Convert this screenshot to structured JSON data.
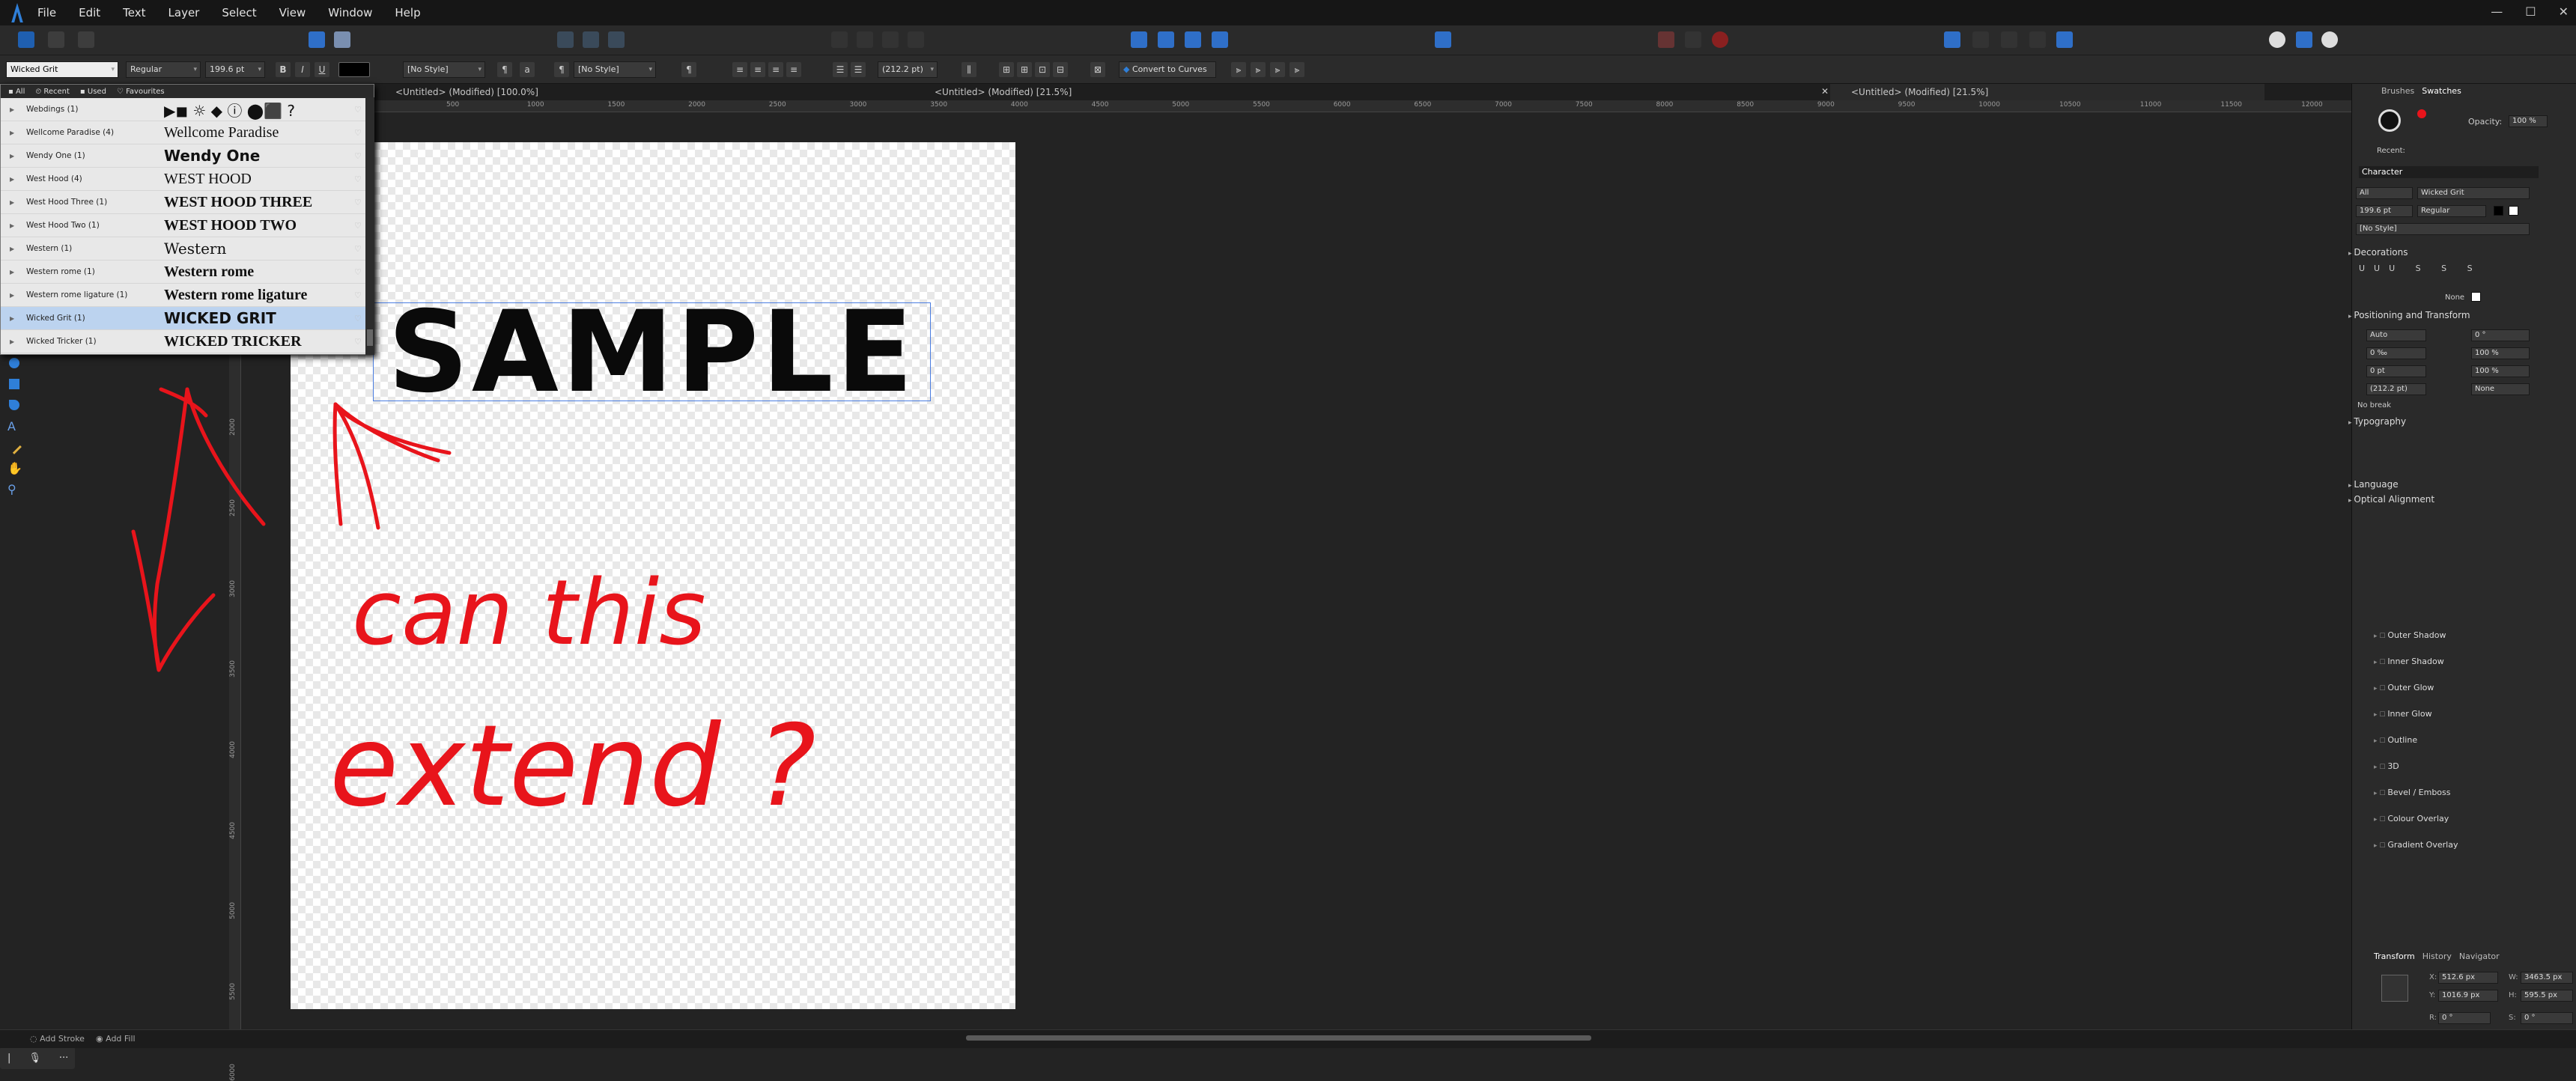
{
  "menu": [
    "File",
    "Edit",
    "Text",
    "Layer",
    "Select",
    "View",
    "Window",
    "Help"
  ],
  "window_controls": [
    "—",
    "☐",
    "✕"
  ],
  "context": {
    "font_family": "Wicked Grit",
    "font_style": "Regular",
    "font_size": "199.6 pt",
    "para_style": "[No Style]",
    "char_style": "[No Style]",
    "leading": "(212.2 pt)",
    "convert": "Convert to Curves"
  },
  "tabs": [
    "<Untitled> (Modified) [100.0%]",
    "<Untitled> (Modified) [21.5%]",
    "<Untitled> (Modified) [21.5%]"
  ],
  "ruler_top": [
    "500",
    "1000",
    "1500",
    "2000",
    "2500",
    "3000",
    "3500",
    "4000",
    "4500",
    "5000",
    "5500",
    "6000",
    "6500",
    "7000",
    "7500",
    "8000",
    "8500",
    "9000",
    "9500",
    "10000",
    "10500",
    "11000",
    "11500",
    "12000"
  ],
  "ruler_left": [
    "500",
    "1000",
    "1500",
    "2000",
    "2500",
    "3000",
    "3500",
    "4000",
    "4500",
    "5000",
    "5500",
    "6000"
  ],
  "font_filter": [
    "All",
    "Recent",
    "Used",
    "Favourites"
  ],
  "fonts": [
    {
      "name": "Webdings (1)",
      "preview": "▶◼ ☼ ◆ ⓘ ⬤⬛ ?"
    },
    {
      "name": "Wellcome Paradise (4)",
      "preview": "Wellcome Paradise"
    },
    {
      "name": "Wendy One (1)",
      "preview": "Wendy One"
    },
    {
      "name": "West Hood (4)",
      "preview": "WEST HOOD"
    },
    {
      "name": "West Hood Three (1)",
      "preview": "WEST HOOD THREE"
    },
    {
      "name": "West Hood Two (1)",
      "preview": "WEST HOOD TWO"
    },
    {
      "name": "Western (1)",
      "preview": "Western"
    },
    {
      "name": "Western rome (1)",
      "preview": "Western rome"
    },
    {
      "name": "Western rome ligature (1)",
      "preview": "Western rome ligature"
    },
    {
      "name": "Wicked Grit (1)",
      "preview": "WICKED GRIT",
      "selected": true
    },
    {
      "name": "Wicked Tricker (1)",
      "preview": "WICKED TRICKER"
    }
  ],
  "canvas_text": "SAMPLE",
  "right": {
    "top_tabs": [
      "Brushes",
      "Swatches"
    ],
    "opacity_label": "Opacity:",
    "opacity": "100 %",
    "recent": "Recent:",
    "character_title": "Character",
    "char_all": "All",
    "char_font": "Wicked Grit",
    "char_size": "199.6 pt",
    "char_style": "Regular",
    "char_nostyle": "[No Style]",
    "decorations": "Decorations",
    "none": "None",
    "positioning": "Positioning and Transform",
    "pos_fields": [
      "Auto",
      "0 ‰",
      "0 pt",
      "(212.2 pt)"
    ],
    "pos_fields_r": [
      "0 °",
      "100 %",
      "100 %",
      "None"
    ],
    "no_break": "No break",
    "typography": "Typography",
    "language": "Language",
    "optical": "Optical Alignment",
    "effects": [
      "Outer Shadow",
      "Inner Shadow",
      "Outer Glow",
      "Inner Glow",
      "Outline",
      "3D",
      "Bevel / Emboss",
      "Colour Overlay",
      "Gradient Overlay"
    ],
    "bottom_tabs": [
      "Transform",
      "History",
      "Navigator"
    ],
    "transform": {
      "x": "512.6 px",
      "y": "1016.9 px",
      "w": "3463.5 px",
      "h": "595.5 px",
      "r": "0 °",
      "s": "0 °"
    }
  },
  "bottom": {
    "add_stroke": "Add Stroke",
    "add_fill": "Add Fill"
  },
  "annotation_text": [
    "can this",
    "extend ?"
  ],
  "colors": {
    "accent": "#2f7fd8",
    "annotation": "#e8141b",
    "selection": "#bcd3ef"
  }
}
